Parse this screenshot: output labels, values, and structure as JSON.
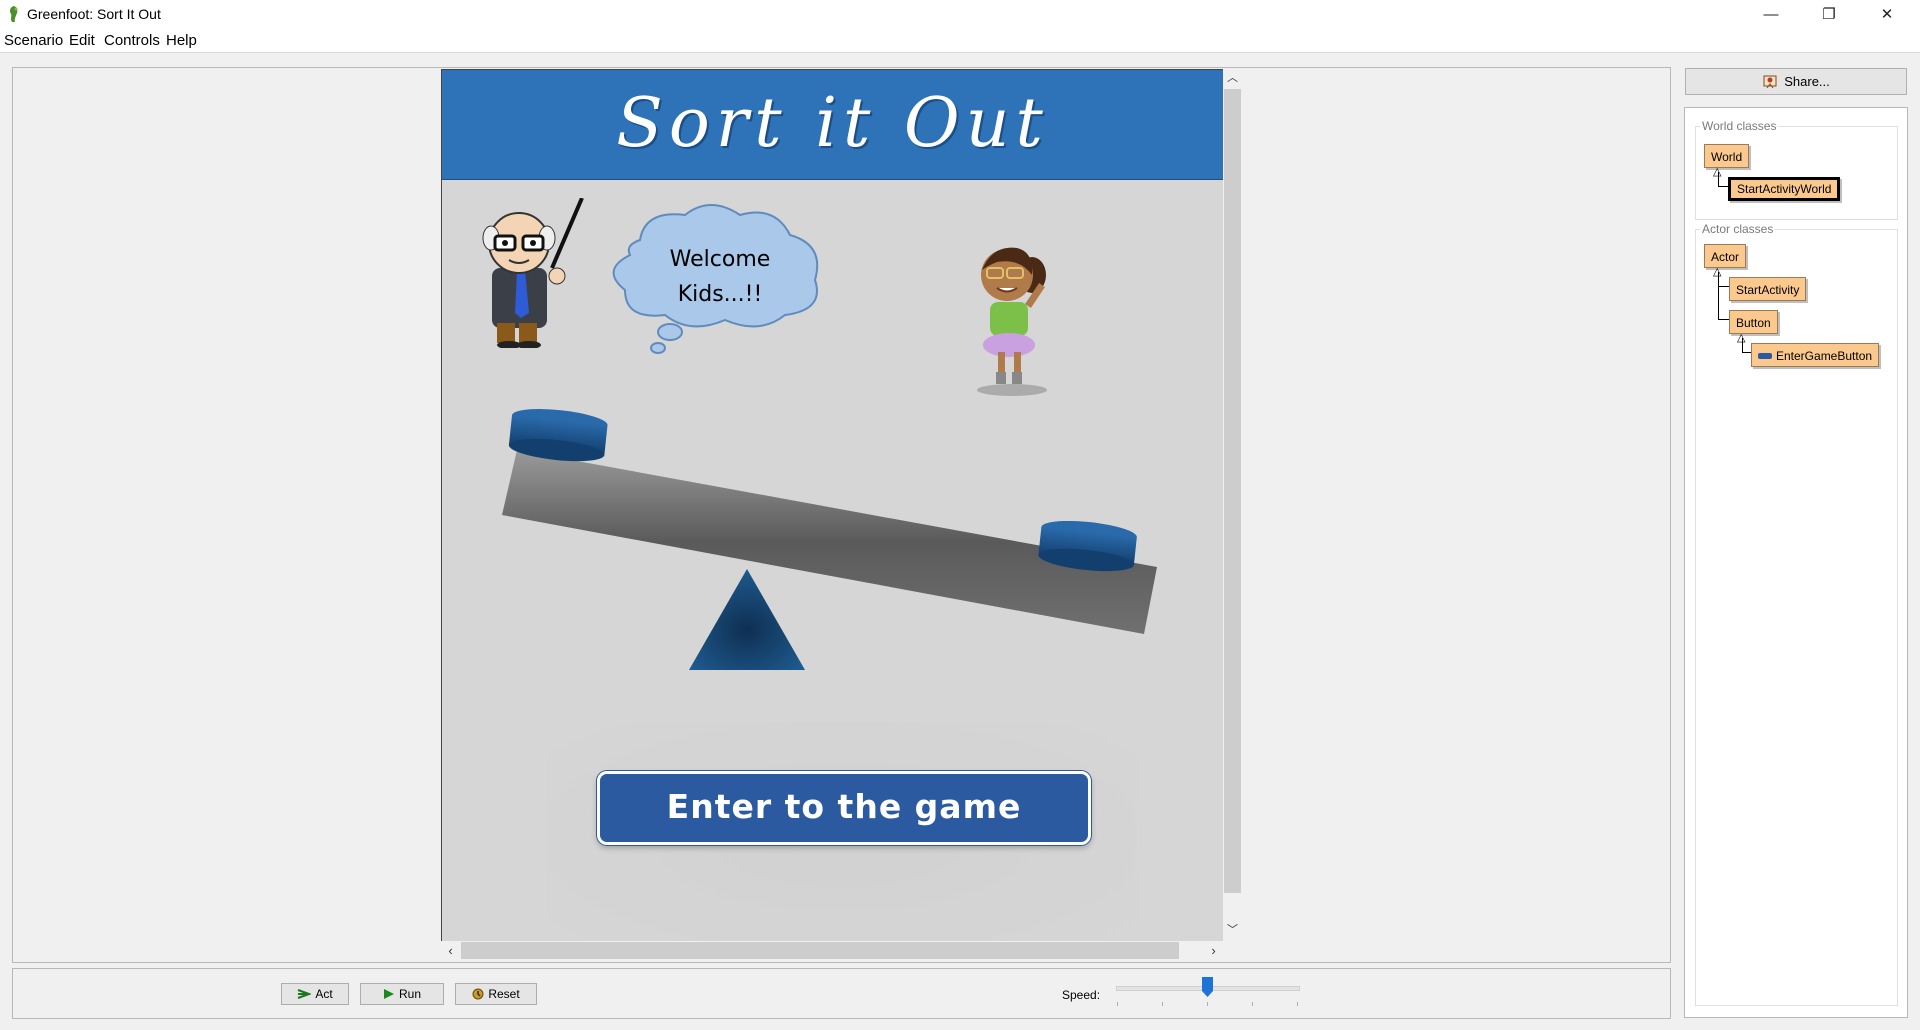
{
  "window": {
    "title": "Greenfoot: Sort It Out",
    "controls": {
      "minimize": "—",
      "restore": "❐",
      "close": "✕"
    }
  },
  "menu": [
    "Scenario",
    "Edit",
    "Controls",
    "Help"
  ],
  "world": {
    "banner_title": "Sort it Out",
    "speech_bubble": [
      "Welcome",
      "Kids...!!"
    ],
    "enter_button": "Enter to the game",
    "colors": {
      "banner": "#2e72b7",
      "button": "#2c5aa0",
      "seesaw_base": "#1e5a8e"
    }
  },
  "controls": {
    "act_label": "Act",
    "run_label": "Run",
    "reset_label": "Reset",
    "speed_label": "Speed:",
    "speed_fraction": 0.5
  },
  "sidebar": {
    "share_label": "Share...",
    "world_classes_label": "World classes",
    "actor_classes_label": "Actor classes",
    "world_classes": [
      "World",
      "StartActivityWorld"
    ],
    "actor_classes": [
      "Actor",
      "StartActivity",
      "Button",
      "EnterGameButton"
    ],
    "selected_class": "StartActivityWorld"
  }
}
